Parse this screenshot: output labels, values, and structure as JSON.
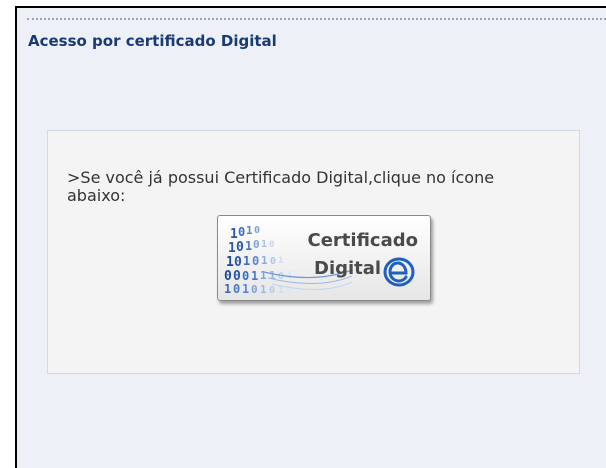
{
  "panel": {
    "title": "Acesso por certificado Digital"
  },
  "content": {
    "instruction": ">Se você já possui Certificado Digital,clique no ícone abaixo:"
  },
  "certificate_button": {
    "line1": "Certificado",
    "line2": "Digital",
    "icon": "e-cpf-logo-icon"
  },
  "colors": {
    "title": "#1a3a73",
    "panel_background": "#edf1f7",
    "content_background": "#f4f4f4",
    "logo_blue": "#1f5fbf"
  }
}
